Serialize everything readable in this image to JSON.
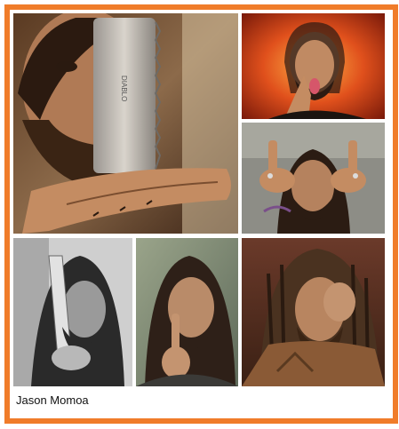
{
  "caption": "Jason Momoa",
  "colors": {
    "frame": "#f07c2a",
    "background": "#ffffff"
  },
  "tiles": [
    {
      "name": "photo-knife-closeup",
      "description_icon": "man-holding-cleaver-icon"
    },
    {
      "name": "photo-fire-background",
      "description_icon": "man-tongue-out-rock-sign-icon"
    },
    {
      "name": "photo-fingers-up",
      "description_icon": "man-hands-raised-icon"
    },
    {
      "name": "photo-bw-knife",
      "description_icon": "man-holding-knife-icon"
    },
    {
      "name": "photo-shush",
      "description_icon": "man-shush-gesture-icon"
    },
    {
      "name": "photo-dreadlocks-hand-on-face",
      "description_icon": "man-hand-on-face-icon"
    }
  ]
}
